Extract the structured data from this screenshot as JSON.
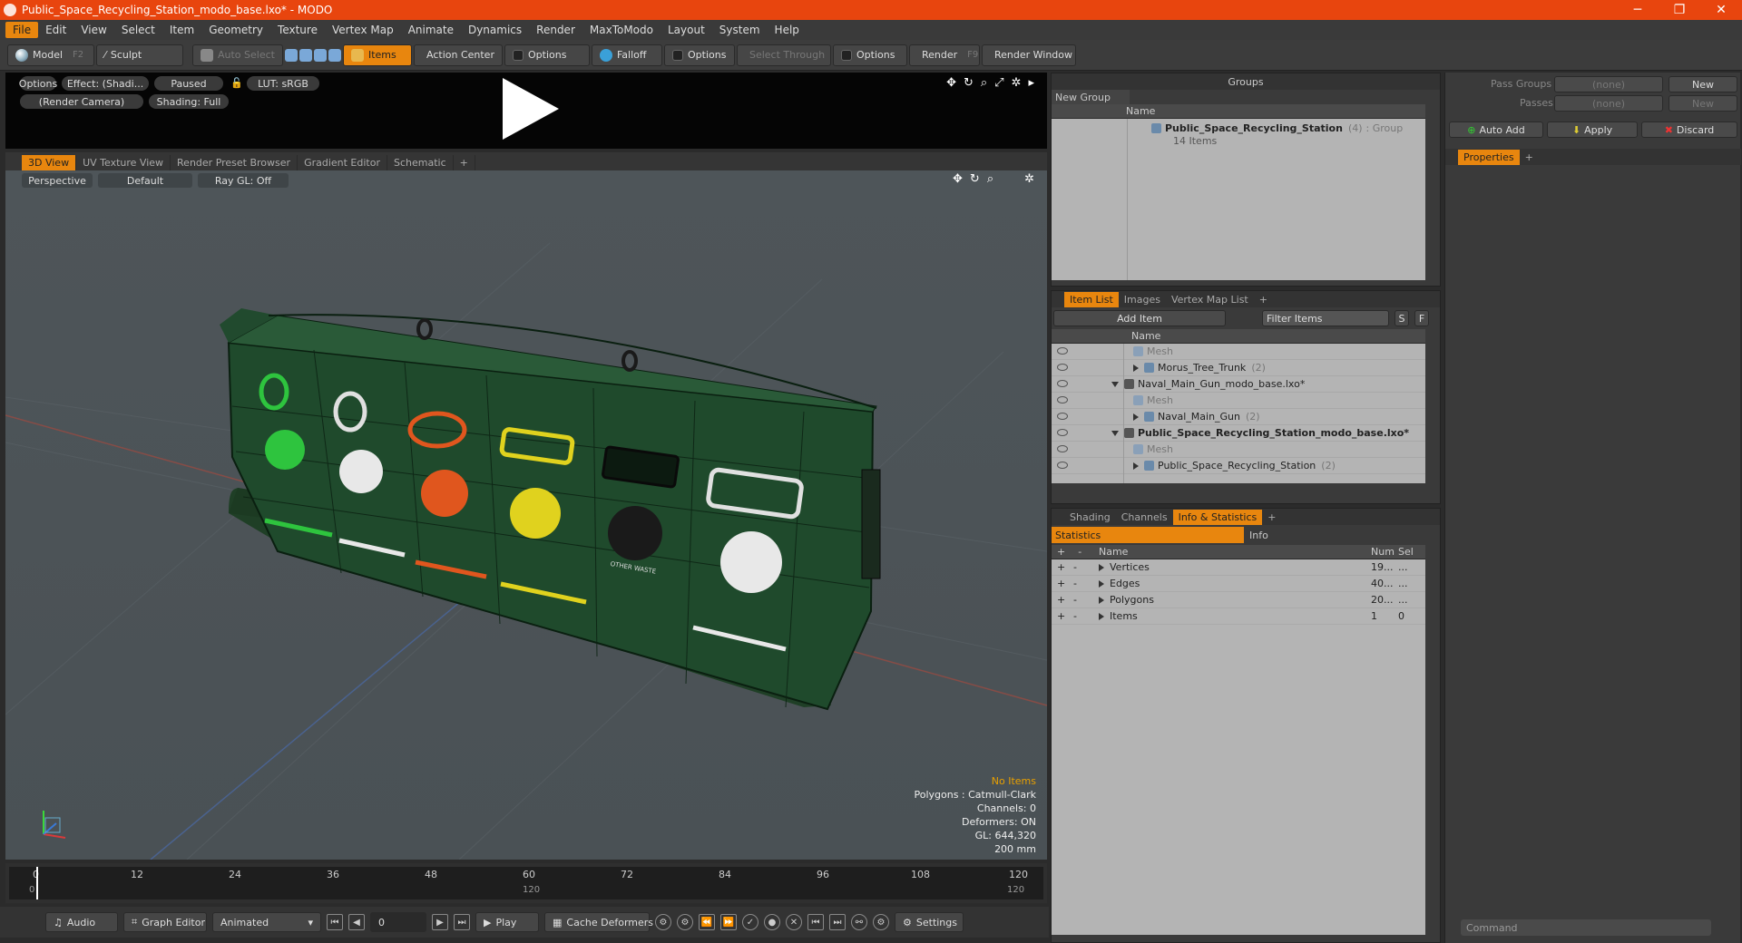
{
  "window": {
    "title": "Public_Space_Recycling_Station_modo_base.lxo* - MODO"
  },
  "menu": [
    "File",
    "Edit",
    "View",
    "Select",
    "Item",
    "Geometry",
    "Texture",
    "Vertex Map",
    "Animate",
    "Dynamics",
    "Render",
    "MaxToModo",
    "Layout",
    "System",
    "Help"
  ],
  "toolbar": {
    "model": "Model",
    "model_key": "F2",
    "sculpt": "Sculpt",
    "auto_select": "Auto Select",
    "items": "Items",
    "action_center": "Action Center",
    "options1": "Options",
    "falloff": "Falloff",
    "options2": "Options",
    "select_through": "Select Through",
    "options3": "Options",
    "render": "Render",
    "render_key": "F9",
    "render_window": "Render Window"
  },
  "preview": {
    "options": "Options",
    "effect": "Effect: (Shadi...",
    "paused": "Paused",
    "lut": "LUT: sRGB",
    "camera": "(Render Camera)",
    "shading": "Shading: Full"
  },
  "viewport_tabs": [
    "3D View",
    "UV Texture View",
    "Render Preset Browser",
    "Gradient Editor",
    "Schematic",
    "+"
  ],
  "viewport": {
    "perspective": "Perspective",
    "default": "Default",
    "raygl": "Ray GL: Off",
    "info": {
      "no_items": "No Items",
      "polygons": "Polygons : Catmull-Clark",
      "channels": "Channels: 0",
      "deformers": "Deformers: ON",
      "gl": "GL: 644,320",
      "size": "200 mm"
    },
    "model_labels": {
      "other_waste": "OTHER WASTE"
    }
  },
  "timeline": {
    "ticks": [
      "0",
      "12",
      "24",
      "36",
      "48",
      "60",
      "72",
      "84",
      "96",
      "108",
      "120"
    ],
    "sub_ticks": [
      "0",
      "120",
      "120"
    ]
  },
  "bottom": {
    "audio": "Audio",
    "graph_editor": "Graph Editor",
    "animated": "Animated",
    "frame": "0",
    "play": "Play",
    "cache": "Cache Deformers",
    "settings": "Settings"
  },
  "groups": {
    "title": "Groups",
    "new_group": "New Group",
    "col_name": "Name",
    "group_name": "Public_Space_Recycling_Station",
    "group_count": "(4)",
    "group_type": ": Group",
    "group_items": "14 Items"
  },
  "pass": {
    "pass_groups": "Pass Groups",
    "passes": "Passes",
    "none1": "(none)",
    "none2": "(none)",
    "new1": "New",
    "new2": "New",
    "auto_add": "Auto Add",
    "apply": "Apply",
    "discard": "Discard",
    "properties": "Properties"
  },
  "itemlist": {
    "tabs": [
      "Item List",
      "Images",
      "Vertex Map List",
      "+"
    ],
    "add_item": "Add Item",
    "filter": "Filter Items",
    "s": "S",
    "f": "F",
    "col_name": "Name",
    "rows": [
      {
        "label": "Mesh",
        "style": "grey",
        "indent": 90,
        "kind": "mesh"
      },
      {
        "label": "Morus_Tree_Trunk",
        "count": "(2)",
        "indent": 90,
        "kind": "loc"
      },
      {
        "label": "Naval_Main_Gun_modo_base.lxo*",
        "indent": 66,
        "kind": "scene"
      },
      {
        "label": "Mesh",
        "style": "grey",
        "indent": 90,
        "kind": "mesh"
      },
      {
        "label": "Naval_Main_Gun",
        "count": "(2)",
        "indent": 90,
        "kind": "loc"
      },
      {
        "label": "Public_Space_Recycling_Station_modo_base.lxo*",
        "style": "bold",
        "indent": 66,
        "kind": "scene"
      },
      {
        "label": "Mesh",
        "style": "grey",
        "indent": 90,
        "kind": "mesh"
      },
      {
        "label": "Public_Space_Recycling_Station",
        "count": "(2)",
        "indent": 90,
        "kind": "loc"
      }
    ]
  },
  "stats": {
    "tabs": [
      "Shading",
      "Channels",
      "Info & Statistics",
      "+"
    ],
    "statistics": "Statistics",
    "info": "Info",
    "col_name": "Name",
    "col_num": "Num",
    "col_sel": "Sel",
    "rows": [
      {
        "name": "Vertices",
        "num": "19...",
        "sel": "..."
      },
      {
        "name": "Edges",
        "num": "40...",
        "sel": "..."
      },
      {
        "name": "Polygons",
        "num": "20...",
        "sel": "..."
      },
      {
        "name": "Items",
        "num": "1",
        "sel": "0"
      }
    ]
  },
  "command": {
    "placeholder": "Command"
  }
}
